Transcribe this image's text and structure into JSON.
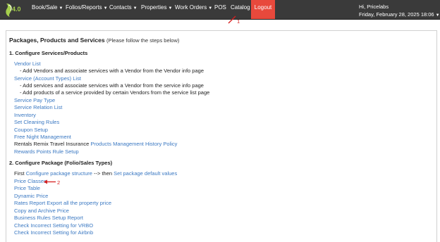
{
  "app": {
    "logo_version": "4.0",
    "accent_colors": {
      "nav_bg": "#3a3a3a",
      "logout_bg": "#e8493c",
      "link": "#3a78c2",
      "annotation": "#d62020"
    }
  },
  "navbar": {
    "items": [
      {
        "label": "Book/Sale",
        "dropdown": true
      },
      {
        "label": "Folios/Reports",
        "dropdown": true
      },
      {
        "label": "Contacts",
        "dropdown": true
      },
      {
        "label": "Properties",
        "dropdown": true
      },
      {
        "label": "Work Orders",
        "dropdown": true
      },
      {
        "label": "POS",
        "dropdown": false
      },
      {
        "label": "Catalog",
        "dropdown": false
      }
    ],
    "logout_label": "Logout",
    "user_greeting": "Hi, Pricelabs",
    "datetime": "Friday, February 28, 2025 18:06"
  },
  "annotations": {
    "one": "1",
    "two": "2"
  },
  "page": {
    "title": "Packages, Products and Services",
    "subtitle": "(Please follow the steps below)"
  },
  "section1": {
    "heading": "1. Configure Services/Products",
    "vendor_list": "Vendor List",
    "vendor_note": "- Add Vendors and associate services with a Vendor from the Vendor info page",
    "service_list": "Service (Account Types) List",
    "service_note1": "- Add services and associate services with a Vendor from the service info page",
    "service_note2": "- Add products of a service provided by certain Vendors from the service list page",
    "service_pay_type": "Service Pay Type",
    "service_relation_list": "Service Relation List",
    "inventory": "Inventory",
    "set_cleaning_rules": "Set Cleaning Rules",
    "coupon_setup": "Coupon Setup",
    "free_night_management": "Free Night Management",
    "rentals_remix_label": "Rentals Remix Travel Insurance",
    "products_management": "Products Management",
    "history_policy": "History Policy",
    "rewards_points": "Rewards Points Rule Setup"
  },
  "section2": {
    "heading": "2. Configure Package (Folio/Sales Types)",
    "first_label": "First",
    "configure_package_structure": "Configure package structure",
    "then_label": "--> then",
    "set_package_defaults": "Set package default values",
    "price_classes": "Price Classes",
    "price_table": "Price Table",
    "dynamic_price": "Dynamic Price",
    "rates_report": "Rates Report",
    "export_all_price": "Export all the property price",
    "copy_archive_price": "Copy and Archive Price",
    "business_rules_report": "Business Rules Setup Report",
    "check_vrbo": "Check Incorrect Setting for VRBO",
    "check_airbnb": "Check Incorrect Setting for Airbnb"
  }
}
